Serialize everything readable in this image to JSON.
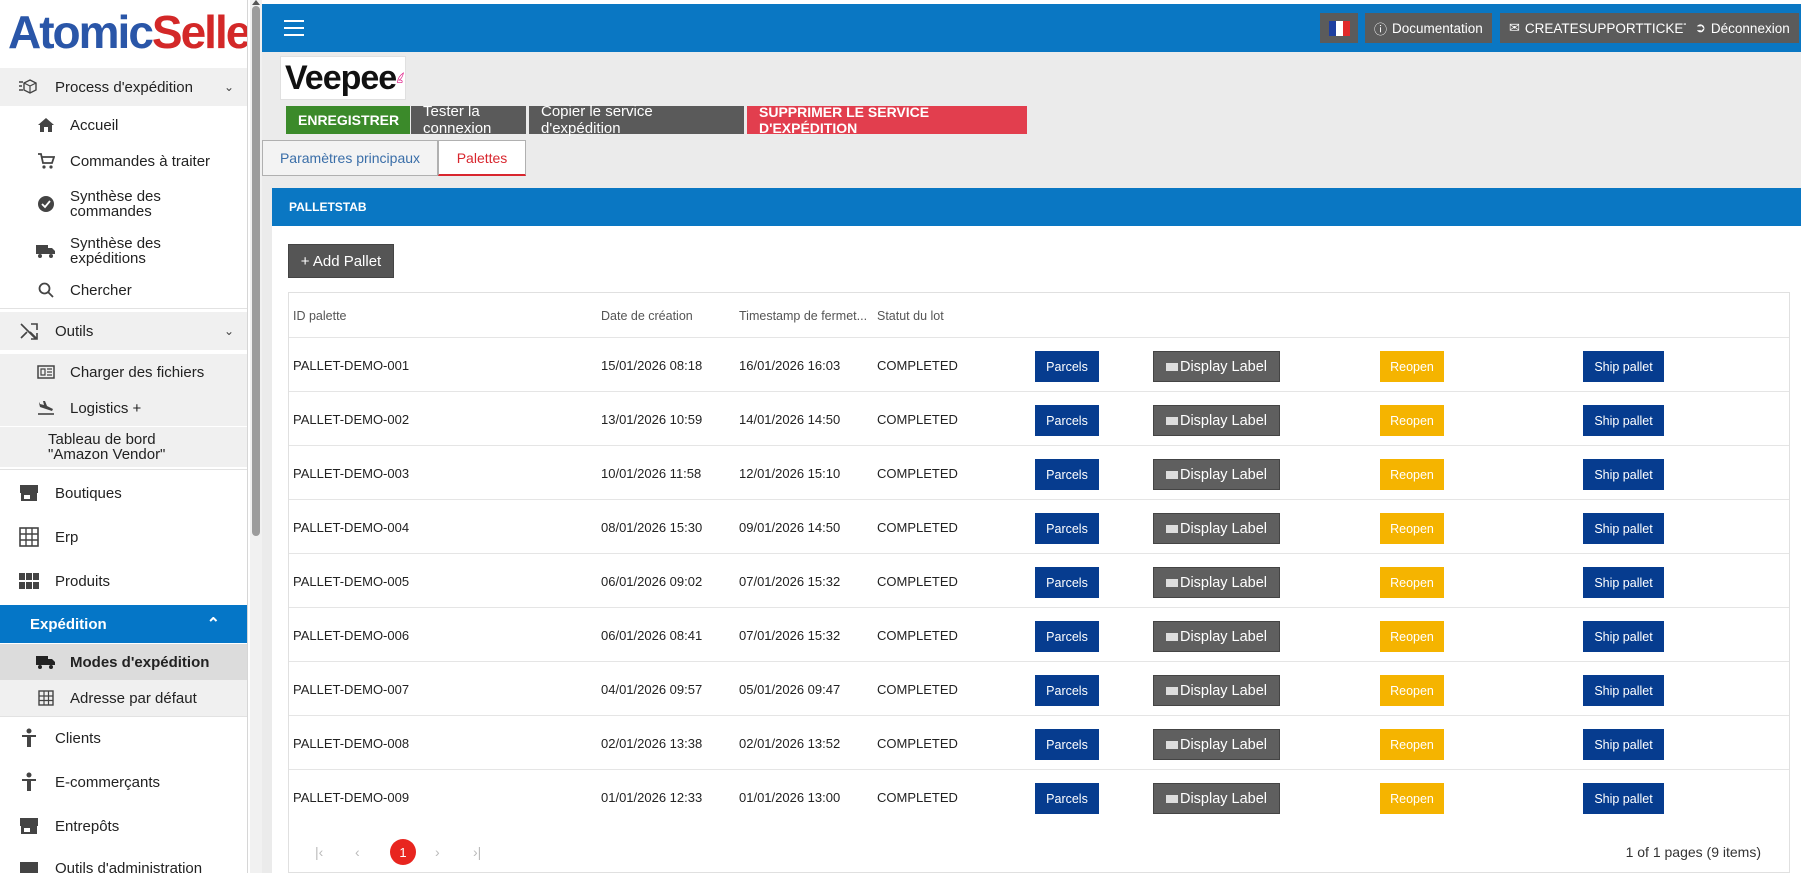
{
  "logo": {
    "part1": "Atomic",
    "part2": "Seller"
  },
  "sidebar": {
    "process": "Process d'expédition",
    "accueil": "Accueil",
    "commandes": "Commandes à traiter",
    "synth_cmd": "Synthèse des commandes",
    "synth_exp": "Synthèse des expéditions",
    "chercher": "Chercher",
    "outils": "Outils",
    "charger": "Charger des fichiers",
    "logistics": "Logistics +",
    "tableau": "Tableau de bord \"Amazon Vendor\"",
    "boutiques": "Boutiques",
    "erp": "Erp",
    "produits": "Produits",
    "expedition": "Expédition",
    "modes": "Modes d'expédition",
    "adresse": "Adresse par défaut",
    "clients": "Clients",
    "ecommercants": "E-commerçants",
    "entrepots": "Entrepôts",
    "outils_admin": "Outils d'administration"
  },
  "topbar": {
    "documentation": "Documentation",
    "support": "CREATESUPPORTTICKET",
    "logout": "Déconnexion"
  },
  "brand": {
    "name": "Veepee"
  },
  "actions": {
    "save": "ENREGISTRER",
    "test": "Tester la connexion",
    "copy": "Copier le service d'expédition",
    "delete": "SUPPRIMER LE SERVICE D'EXPÉDITION"
  },
  "tabs": {
    "main": "Paramètres principaux",
    "pallets": "Palettes"
  },
  "panel": {
    "title": "PALLETSTAB",
    "add": "+ Add Pallet"
  },
  "table": {
    "headers": [
      "ID palette",
      "Date de création",
      "Timestamp de fermet...",
      "Statut du lot"
    ],
    "btn_parcels": "Parcels",
    "btn_label": "Display Label",
    "btn_reopen": "Reopen",
    "btn_ship": "Ship pallet",
    "rows": [
      {
        "id": "PALLET-DEMO-001",
        "created": "15/01/2026 08:18",
        "closed": "16/01/2026 16:03",
        "status": "COMPLETED"
      },
      {
        "id": "PALLET-DEMO-002",
        "created": "13/01/2026 10:59",
        "closed": "14/01/2026 14:50",
        "status": "COMPLETED"
      },
      {
        "id": "PALLET-DEMO-003",
        "created": "10/01/2026 11:58",
        "closed": "12/01/2026 15:10",
        "status": "COMPLETED"
      },
      {
        "id": "PALLET-DEMO-004",
        "created": "08/01/2026 15:30",
        "closed": "09/01/2026 14:50",
        "status": "COMPLETED"
      },
      {
        "id": "PALLET-DEMO-005",
        "created": "06/01/2026 09:02",
        "closed": "07/01/2026 15:32",
        "status": "COMPLETED"
      },
      {
        "id": "PALLET-DEMO-006",
        "created": "06/01/2026 08:41",
        "closed": "07/01/2026 15:32",
        "status": "COMPLETED"
      },
      {
        "id": "PALLET-DEMO-007",
        "created": "04/01/2026 09:57",
        "closed": "05/01/2026 09:47",
        "status": "COMPLETED"
      },
      {
        "id": "PALLET-DEMO-008",
        "created": "02/01/2026 13:38",
        "closed": "02/01/2026 13:52",
        "status": "COMPLETED"
      },
      {
        "id": "PALLET-DEMO-009",
        "created": "01/01/2026 12:33",
        "closed": "01/01/2026 13:00",
        "status": "COMPLETED"
      }
    ]
  },
  "pager": {
    "current": "1",
    "info": "1 of 1 pages (9 items)"
  }
}
